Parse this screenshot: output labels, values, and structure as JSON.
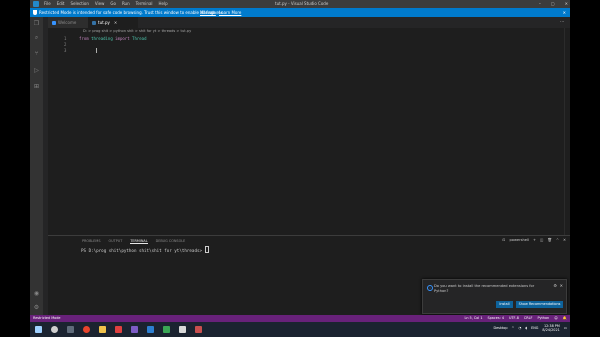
{
  "titlebar": {
    "menu": [
      "File",
      "Edit",
      "Selection",
      "View",
      "Go",
      "Run",
      "Terminal",
      "Help"
    ],
    "window_title": "tut.py - Visual Studio Code"
  },
  "banner": {
    "message": "Restricted Mode is intended for safe code browsing. Trust this window to enable all features.",
    "manage": "Manage",
    "learn_more": "Learn More"
  },
  "tabs": [
    {
      "label": "Welcome",
      "active": false
    },
    {
      "label": "tut.py",
      "active": true
    }
  ],
  "breadcrumb": "D: > prog shit > python shit > shit for yt > threads > tut.py",
  "editor": {
    "line_numbers": [
      "1",
      "2",
      "3"
    ],
    "code_line1_kw1": "from",
    "code_line1_mod": "threading",
    "code_line1_kw2": "import",
    "code_line1_name": "Thread"
  },
  "panel": {
    "tabs": [
      "PROBLEMS",
      "OUTPUT",
      "TERMINAL",
      "DEBUG CONSOLE"
    ],
    "active_tab": "TERMINAL",
    "shell": "powershell",
    "terminal_line": "PS D:\\prog shit\\python shit\\shit for yt\\threads> "
  },
  "notification": {
    "message": "Do you want to install the recommended extensions for Python?",
    "install": "Install",
    "show_recs": "Show Recommendations"
  },
  "status": {
    "left": "Restricted Mode",
    "right": [
      "Ln 5, Col 1",
      "Spaces: 4",
      "UTF-8",
      "CRLF",
      "Python"
    ]
  },
  "taskbar": {
    "desktop": "Desktop",
    "lang": "ENG",
    "time": "12:38 PM",
    "date": "8/24/2021"
  }
}
